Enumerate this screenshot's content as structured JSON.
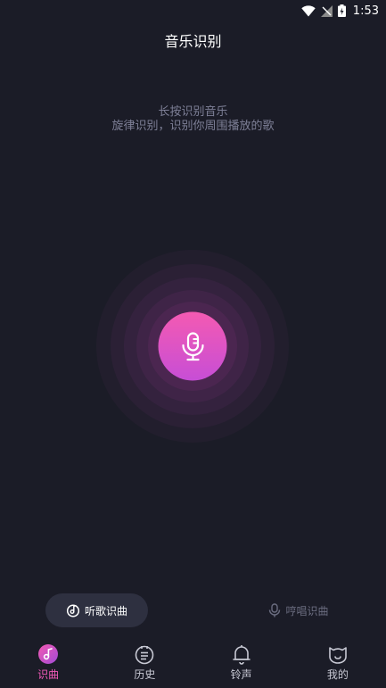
{
  "status_bar": {
    "time": "1:53"
  },
  "header": {
    "title": "音乐识别"
  },
  "hint": {
    "line1": "长按识别音乐",
    "line2": "旋律识别，识别你周围播放的歌"
  },
  "mic": {
    "icon": "microphone-icon",
    "accent_top": "#f45ab2",
    "accent_bottom": "#c74ed6"
  },
  "modes": {
    "listen_label": "听歌识曲",
    "hum_label": "哼唱识曲"
  },
  "nav": {
    "items": [
      {
        "label": "识曲",
        "icon": "music-note-icon",
        "active": true
      },
      {
        "label": "历史",
        "icon": "history-icon",
        "active": false
      },
      {
        "label": "铃声",
        "icon": "bell-icon",
        "active": false
      },
      {
        "label": "我的",
        "icon": "profile-icon",
        "active": false
      }
    ]
  },
  "colors": {
    "background": "#1b1c27",
    "accent": "#f05ab8"
  }
}
